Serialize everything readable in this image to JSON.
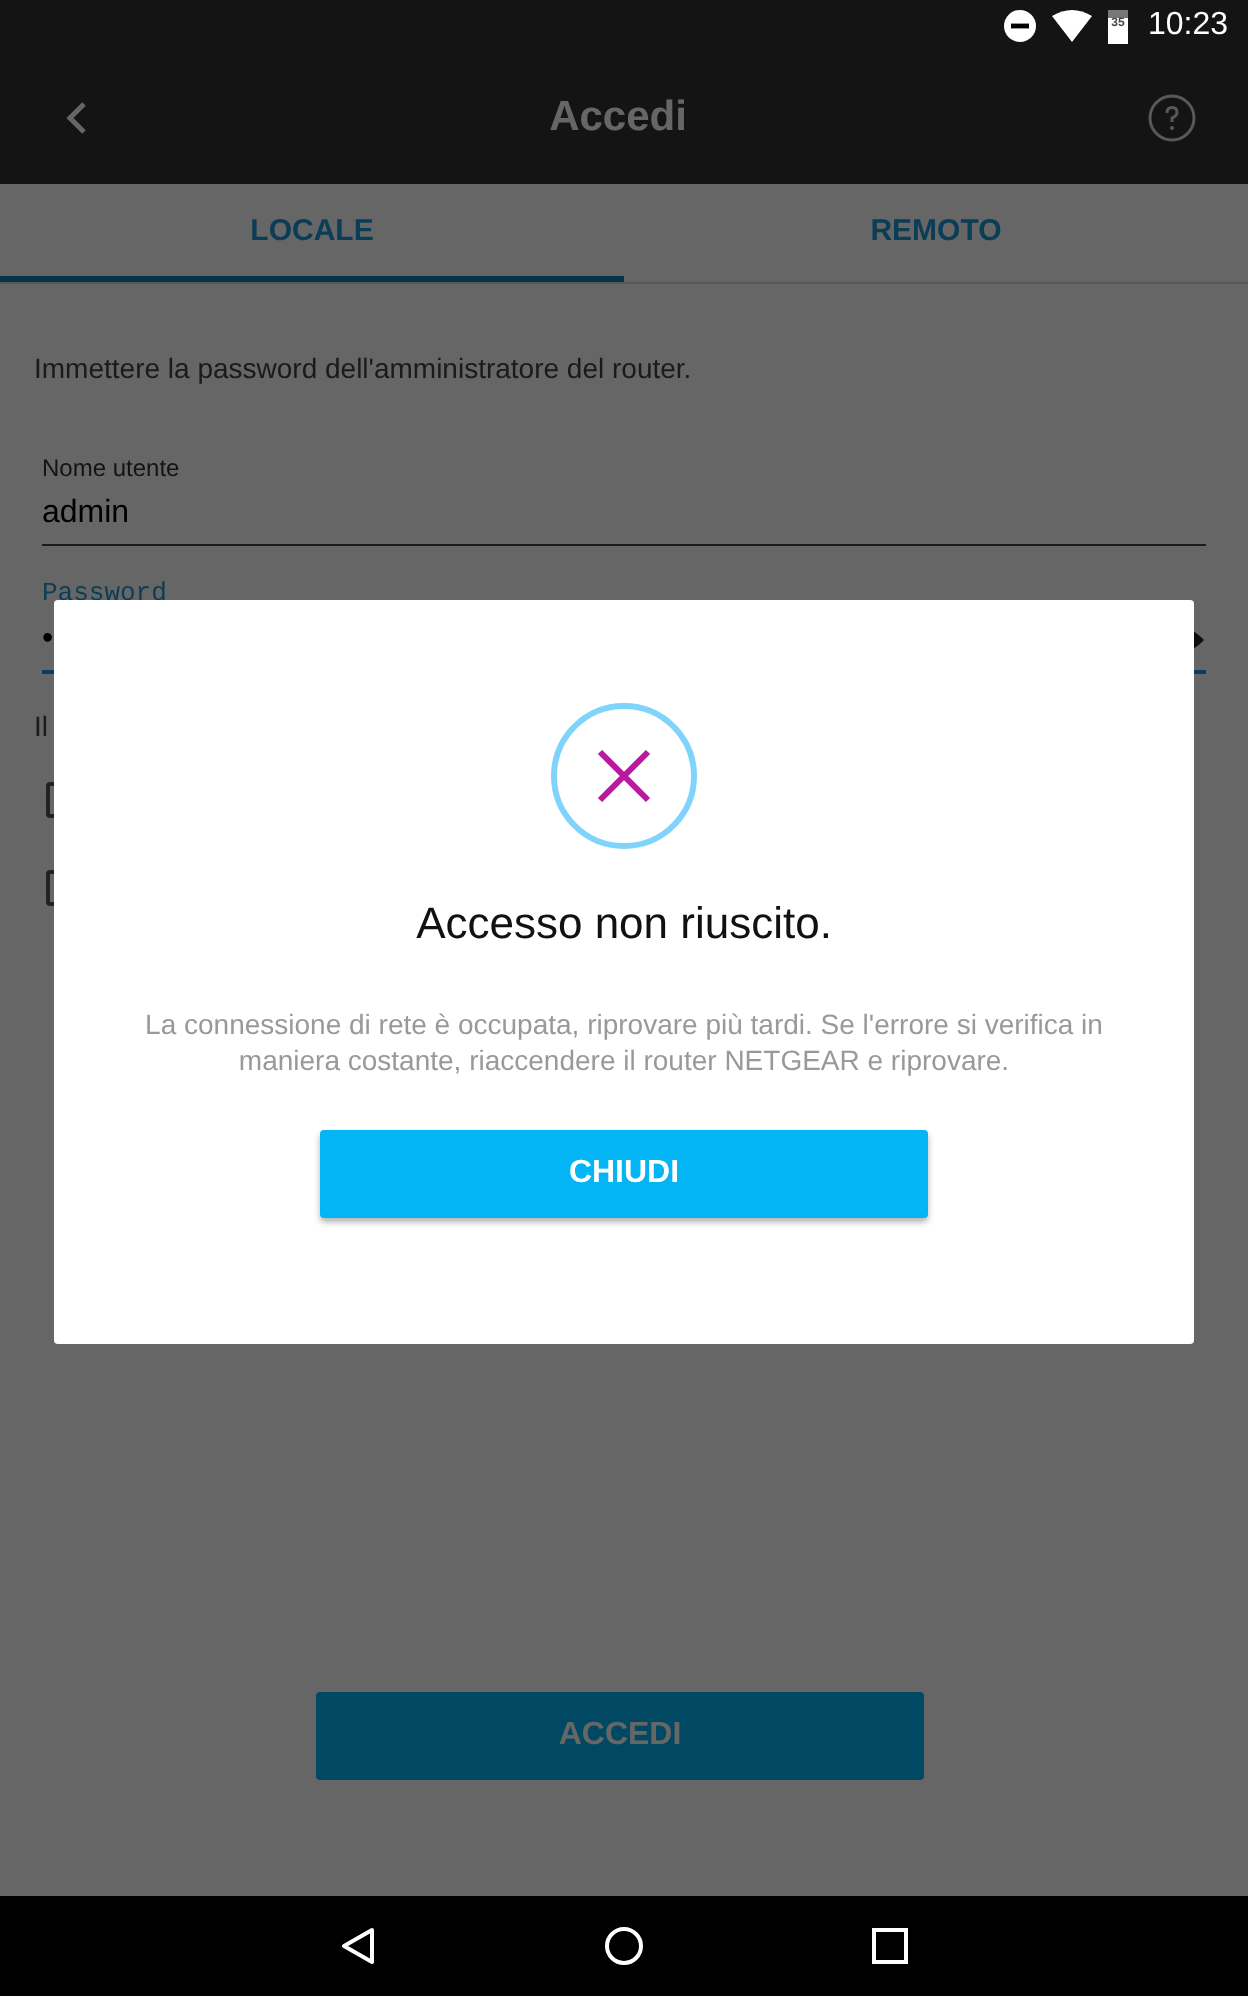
{
  "status_bar": {
    "battery": "35",
    "time": "10:23"
  },
  "app_bar": {
    "title": "Accedi"
  },
  "tabs": [
    {
      "label": "LOCALE",
      "selected": true
    },
    {
      "label": "REMOTO",
      "selected": false
    }
  ],
  "instructions": "Immettere la password dell'amministratore del router.",
  "fields": [
    {
      "label": "Nome utente",
      "value": "admin",
      "focused": false
    },
    {
      "label": "Password",
      "value": "•",
      "focused": true
    }
  ],
  "partial_text": "Il",
  "checkboxes": [
    {
      "checked": false
    },
    {
      "checked": false
    }
  ],
  "login_button": "ACCEDI",
  "dialog": {
    "title": "Accesso non riuscito.",
    "message": "La connessione di rete è occupata, riprovare più tardi. Se l'errore si verifica in maniera costante, riaccendere il router NETGEAR e riprovare.",
    "button": "CHIUDI"
  }
}
